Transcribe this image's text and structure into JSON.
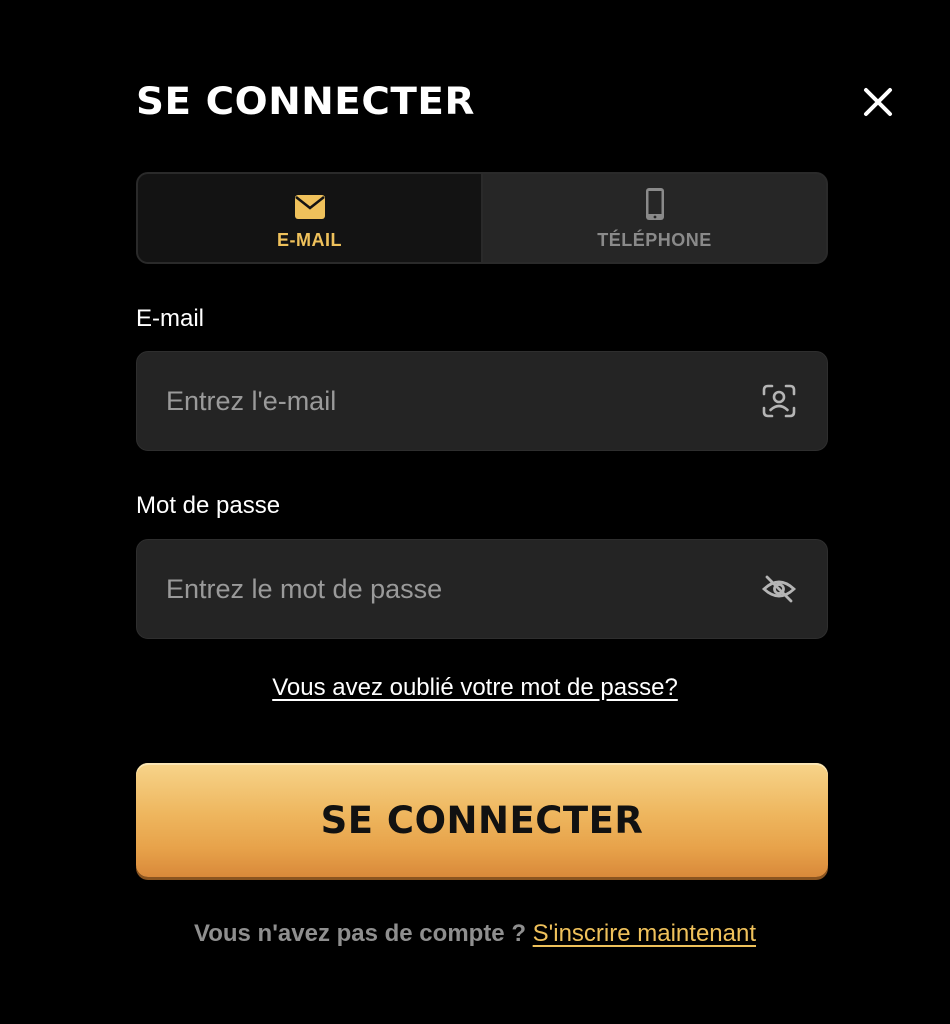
{
  "modal": {
    "title": "SE CONNECTER",
    "close_icon": "close-icon"
  },
  "tabs": [
    {
      "label": "E-MAIL",
      "icon": "envelope-icon",
      "active": true
    },
    {
      "label": "TÉLÉPHONE",
      "icon": "phone-icon",
      "active": false
    }
  ],
  "form": {
    "email": {
      "label": "E-mail",
      "placeholder": "Entrez l'e-mail",
      "value": "",
      "icon": "face-scan-icon"
    },
    "password": {
      "label": "Mot de passe",
      "placeholder": "Entrez le mot de passe",
      "value": "",
      "icon": "eye-off-icon"
    },
    "forgot_link": "Vous avez oublié votre mot de passe?",
    "submit_label": "SE CONNECTER"
  },
  "signup": {
    "question": "Vous n'avez pas de compte ?",
    "link": "S'inscrire maintenant"
  },
  "colors": {
    "background": "#000000",
    "accent": "#efc15b",
    "input_bg": "#242424",
    "muted_text": "#8f8f8f"
  }
}
